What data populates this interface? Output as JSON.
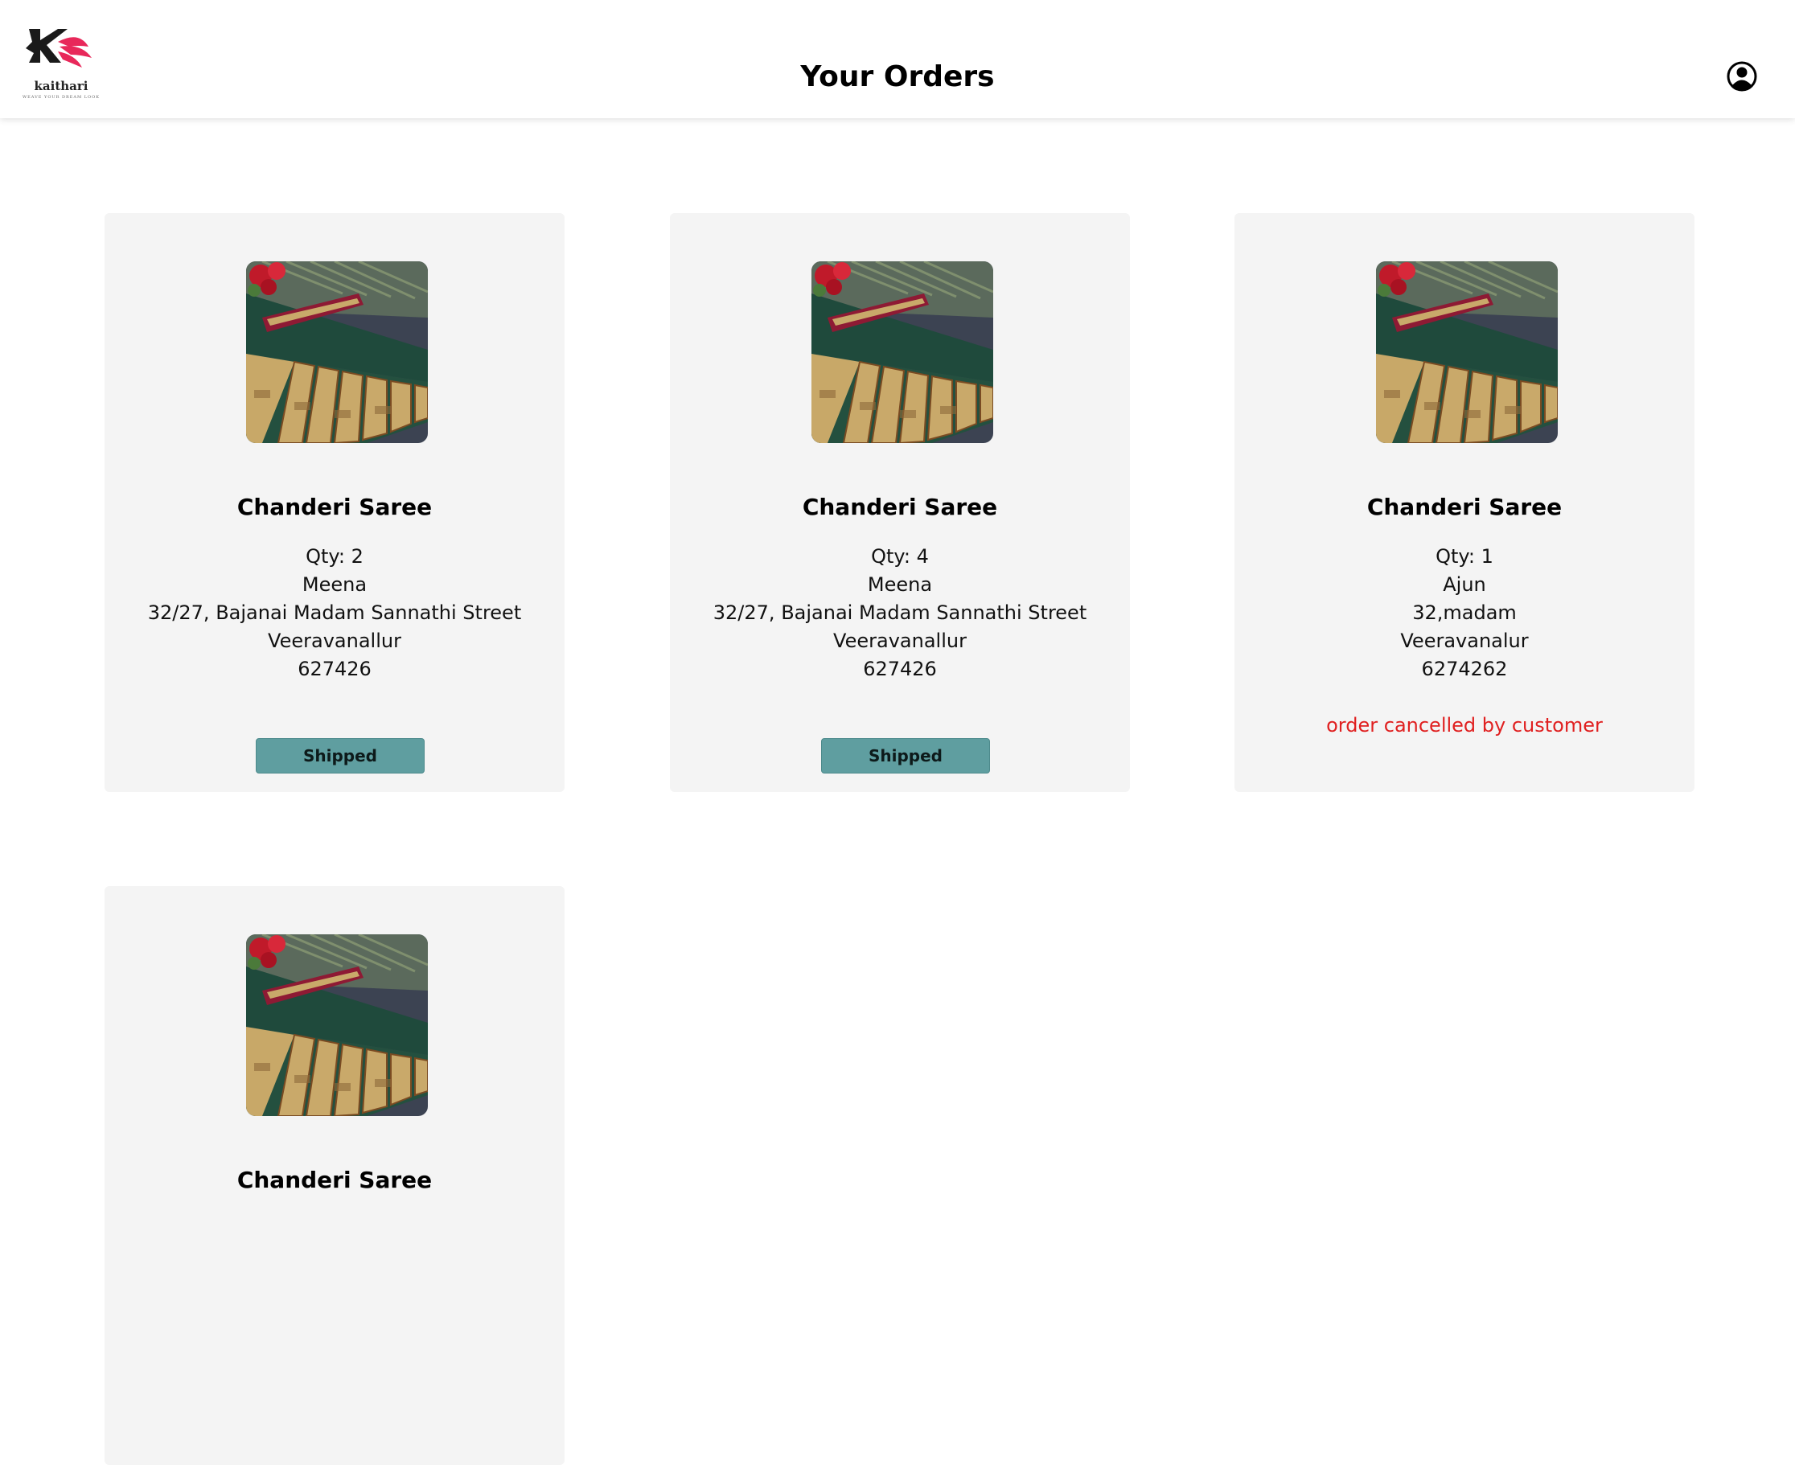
{
  "header": {
    "logo_name": "kaithari",
    "logo_tagline": "WEAVE YOUR DREAM LOOK",
    "title": "Your Orders"
  },
  "orders": [
    {
      "product": "Chanderi Saree",
      "qty": "Qty: 2",
      "name": "Meena",
      "street": "32/27, Bajanai Madam Sannathi Street",
      "city": "Veeravanallur",
      "pincode": "627426",
      "status": "Shipped"
    },
    {
      "product": "Chanderi Saree",
      "qty": "Qty: 4",
      "name": "Meena",
      "street": "32/27, Bajanai Madam Sannathi Street",
      "city": "Veeravanallur",
      "pincode": "627426",
      "status": "Shipped"
    },
    {
      "product": "Chanderi Saree",
      "qty": "Qty: 1",
      "name": "Ajun",
      "street": "32,madam",
      "city": "Veeravanalur",
      "pincode": "6274262",
      "note": "order cancelled by customer"
    },
    {
      "product": "Chanderi Saree"
    }
  ],
  "icons": {
    "logo": "kaithari-logo",
    "account": "user-circle-icon",
    "product_image": "saree-image"
  },
  "colors": {
    "card_bg": "#f4f4f4",
    "status_button": "#5f9ea0",
    "cancel_text": "#e02020",
    "logo_accent": "#e8285a"
  }
}
